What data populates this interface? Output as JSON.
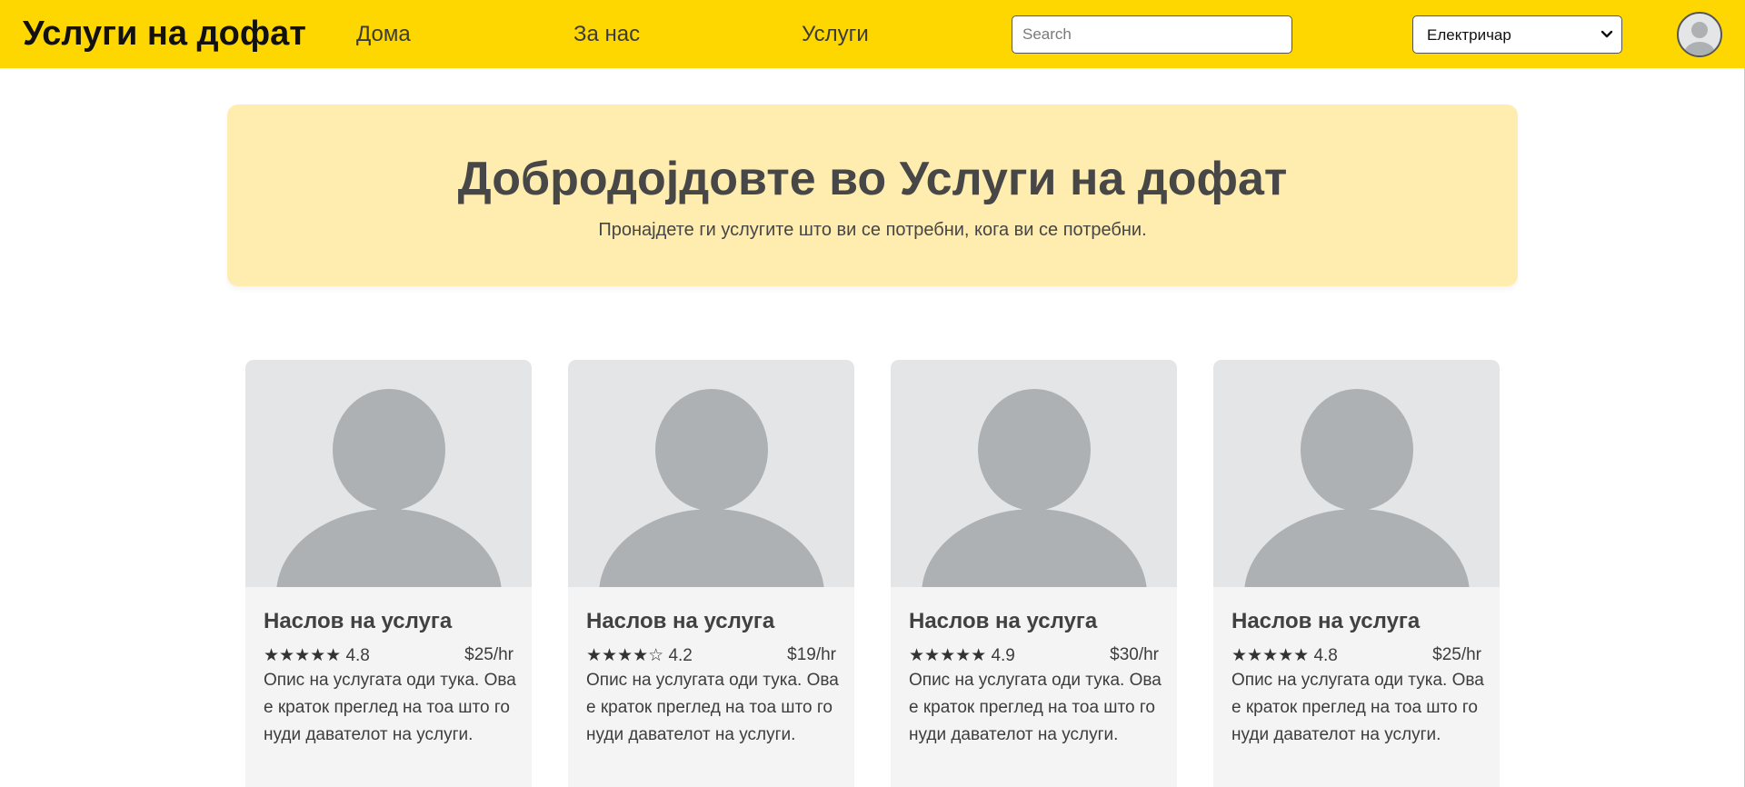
{
  "header": {
    "logo": "Услуги на дофат",
    "nav": [
      "Дома",
      "За нас",
      "Услуги"
    ],
    "search_placeholder": "Search",
    "category_selected": "Електричар"
  },
  "hero": {
    "title": "Добродојдовте во Услуги на дофат",
    "subtitle": "Пронајдете ги услугите што ви се потребни, кога ви се потребни."
  },
  "cards": [
    {
      "title": "Наслов на услуга",
      "stars": "★★★★★",
      "rating": "4.8",
      "price": "$25/hr",
      "description": "Опис на услугата оди тука. Ова е краток преглед на тоа што го нуди давателот на услуги."
    },
    {
      "title": "Наслов на услуга",
      "stars": "★★★★☆",
      "rating": "4.2",
      "price": "$19/hr",
      "description": "Опис на услугата оди тука. Ова е краток преглед на тоа што го нуди давателот на услуги."
    },
    {
      "title": "Наслов на услуга",
      "stars": "★★★★★",
      "rating": "4.9",
      "price": "$30/hr",
      "description": "Опис на услугата оди тука. Ова е краток преглед на тоа што го нуди давателот на услуги."
    },
    {
      "title": "Наслов на услуга",
      "stars": "★★★★★",
      "rating": "4.8",
      "price": "$25/hr",
      "description": "Опис на услугата оди тука. Ова е краток преглед на тоа што го нуди давателот на услуги."
    }
  ],
  "colors": {
    "header_bg": "#FFD700",
    "hero_bg": "#FFEDB0",
    "card_bg": "#f4f4f4",
    "placeholder_bg": "#e4e5e7",
    "placeholder_fg": "#adb1b4"
  },
  "icons": {
    "avatar": "user-silhouette-icon",
    "select_arrow": "chevron-down-icon",
    "card_image": "user-placeholder-icon"
  }
}
